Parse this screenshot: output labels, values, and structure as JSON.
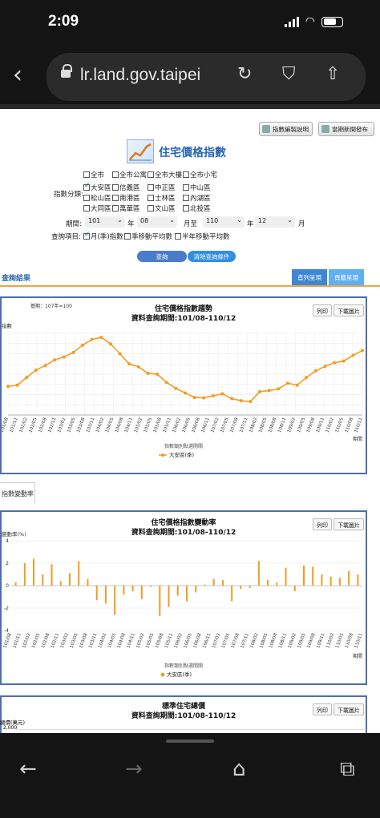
{
  "status": {
    "time": "2:09"
  },
  "browser": {
    "url": "lr.land.gov.taipei"
  },
  "top_buttons": [
    "指數編製說明",
    "當期新聞發布"
  ],
  "page_title": "住宅價格指數",
  "form": {
    "row1": [
      "全市",
      "全市公寓",
      "全市大樓",
      "全市小宅"
    ],
    "index_label": "指數分類:",
    "districts": [
      {
        "label": "大安區",
        "checked": true
      },
      {
        "label": "信義區",
        "checked": false
      },
      {
        "label": "中正區",
        "checked": false
      },
      {
        "label": "中山區",
        "checked": false
      },
      {
        "label": "松山區",
        "checked": false
      },
      {
        "label": "南港區",
        "checked": false
      },
      {
        "label": "士林區",
        "checked": false
      },
      {
        "label": "內湖區",
        "checked": false
      },
      {
        "label": "大同區",
        "checked": false
      },
      {
        "label": "萬華區",
        "checked": false
      },
      {
        "label": "文山區",
        "checked": false
      },
      {
        "label": "北投區",
        "checked": false
      }
    ],
    "period_label": "期間:",
    "from_year": "101",
    "year_unit": "年",
    "from_month": "08",
    "to_label": "月至",
    "to_year": "110",
    "to_month": "12",
    "month_unit": "月",
    "query_label": "查詢項目:",
    "query_items": [
      {
        "label": "月(季)指數",
        "checked": true
      },
      {
        "label": "季移動平均數",
        "checked": false
      },
      {
        "label": "半年移動平均數",
        "checked": false
      }
    ],
    "query_button": "查詢",
    "clear_button": "清除查詢條件"
  },
  "result_title": "查詢結果",
  "view_buttons": [
    "直列呈現",
    "頁籤呈現"
  ],
  "panel_buttons": [
    "列印",
    "下載圖片"
  ],
  "tab_change": "指數變動率",
  "chart_data": [
    {
      "type": "line",
      "title": "住宅價格指數趨勢",
      "subtitle": "資料查詢期間:101/08-110/12",
      "base_note": "基期：107年=100",
      "ylabel": "指數",
      "xlabel": "期間",
      "legend_title": "指數類別點選開關",
      "colors": {
        "series": "#f39c1f"
      },
      "series": [
        {
          "name": "大安區(季)",
          "values": [
            97.0,
            97.3,
            99.2,
            101.0,
            102.1,
            103.5,
            104.2,
            105.3,
            107.1,
            108.5,
            109.0,
            107.4,
            105.0,
            102.5,
            101.8,
            100.2,
            100.0,
            98.0,
            96.5,
            95.4,
            94.3,
            94.2,
            94.7,
            95.2,
            94.0,
            93.5,
            93.3,
            95.7,
            96.0,
            96.4,
            97.8,
            97.3,
            99.2,
            100.8,
            101.9,
            102.8,
            103.2,
            104.6,
            105.8
          ]
        }
      ],
      "x_ticks": [
        "101/08",
        "101/11",
        "102/02",
        "102/05",
        "102/08",
        "102/11",
        "103/02",
        "103/05",
        "103/08",
        "103/11",
        "104/02",
        "104/05",
        "104/08",
        "104/11",
        "105/02",
        "105/05",
        "105/08",
        "105/11",
        "106/02",
        "106/05",
        "106/08",
        "106/11",
        "107/02",
        "107/05",
        "107/08",
        "107/11",
        "108/02",
        "108/05",
        "108/08",
        "108/11",
        "109/02",
        "109/05",
        "109/08",
        "109/11",
        "110/02",
        "110/05",
        "110/08",
        "110/11"
      ]
    },
    {
      "type": "bar",
      "title": "住宅價格指數變動率",
      "subtitle": "資料查詢期間:101/08-110/12",
      "ylabel": "變動率(%)",
      "xlabel": "期間",
      "legend_title": "指數類別點選開關",
      "ylim": [
        -4,
        4
      ],
      "y_ticks": [
        "4",
        "2",
        "0",
        "-2",
        "-4"
      ],
      "colors": {
        "series": "#f39c1f"
      },
      "series": [
        {
          "name": "大安區(季)",
          "values": [
            0.3,
            2.0,
            2.4,
            1.0,
            1.9,
            0.4,
            1.1,
            2.2,
            0.6,
            -1.3,
            -1.6,
            -2.6,
            -0.8,
            -0.5,
            -1.2,
            -0.1,
            -2.7,
            -1.9,
            -0.9,
            -1.4,
            -0.6,
            0.1,
            0.6,
            0.5,
            -1.4,
            -0.3,
            -0.2,
            2.2,
            0.5,
            0.3,
            1.6,
            -0.5,
            1.8,
            1.7,
            1.0,
            0.8,
            0.7,
            1.3,
            1.0
          ]
        }
      ]
    },
    {
      "type": "line",
      "title": "標準住宅總價",
      "subtitle": "資料查詢期間:101/08-110/12",
      "ylabel": "總價(萬元)",
      "y_ticks": [
        "2,000"
      ]
    }
  ]
}
